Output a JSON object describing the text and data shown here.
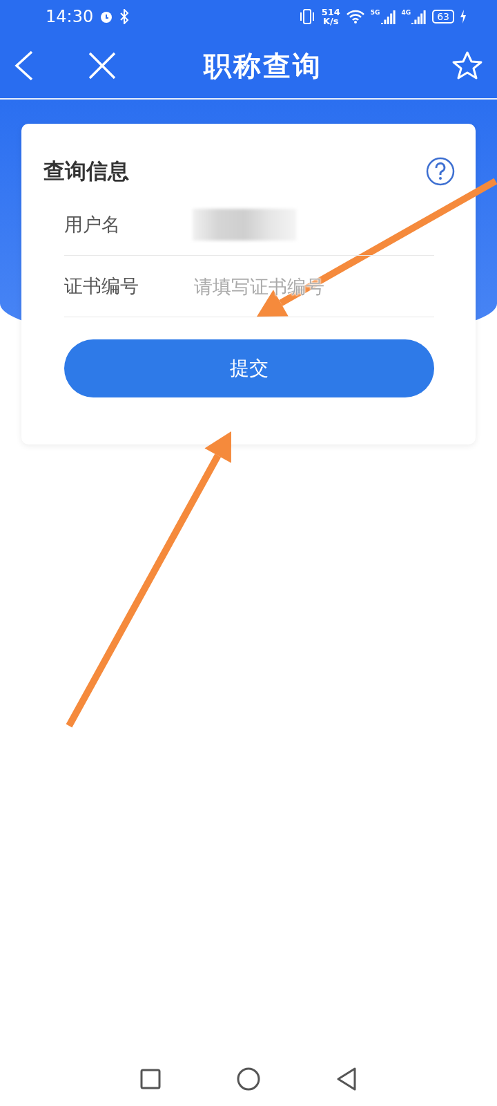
{
  "status_bar": {
    "time": "14:30",
    "speed_value": "514",
    "speed_unit": "K/s",
    "networks": [
      "5G",
      "4G"
    ],
    "battery": "63"
  },
  "nav_bar": {
    "title": "职称查询"
  },
  "card": {
    "title": "查询信息",
    "fields": [
      {
        "kind": "blurred",
        "label": "用户名"
      },
      {
        "kind": "input",
        "label": "证书编号",
        "placeholder": "请填写证书编号"
      }
    ],
    "button": "提交"
  },
  "annotations": [
    {
      "kind": "arrow"
    },
    {
      "kind": "arrow"
    }
  ]
}
